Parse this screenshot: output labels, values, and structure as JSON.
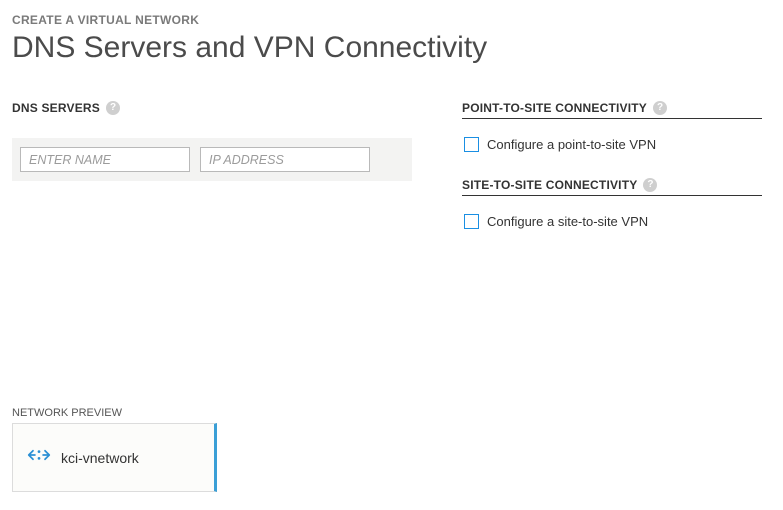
{
  "breadcrumb": "CREATE A VIRTUAL NETWORK",
  "page_title": "DNS Servers and VPN Connectivity",
  "dns": {
    "section_label": "DNS SERVERS",
    "name_placeholder": "ENTER NAME",
    "ip_placeholder": "IP ADDRESS"
  },
  "point_to_site": {
    "section_label": "POINT-TO-SITE CONNECTIVITY",
    "checkbox_label": "Configure a point-to-site VPN",
    "checked": false
  },
  "site_to_site": {
    "section_label": "SITE-TO-SITE CONNECTIVITY",
    "checkbox_label": "Configure a site-to-site VPN",
    "checked": false
  },
  "preview": {
    "label": "NETWORK PREVIEW",
    "network_name": "kci-vnetwork"
  },
  "help_glyph": "?"
}
